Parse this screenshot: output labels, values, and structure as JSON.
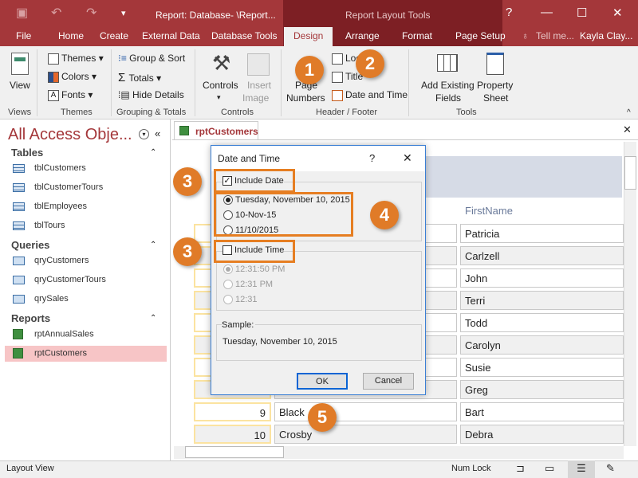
{
  "window": {
    "title": "Report: Database- \\Report...",
    "context_tab_group": "Report Layout Tools",
    "help": "?",
    "minimize": "—",
    "maximize": "☐",
    "close": "✕"
  },
  "tabs": [
    "File",
    "Home",
    "Create",
    "External Data",
    "Database Tools",
    "Design",
    "Arrange",
    "Format",
    "Page Setup"
  ],
  "active_tab": "Design",
  "tell_me": "Tell me...",
  "user": "Kayla Clay...",
  "ribbon": {
    "views": {
      "view": "View",
      "group": "Views"
    },
    "themes": {
      "themes": "Themes",
      "colors": "Colors",
      "fonts": "Fonts",
      "group": "Themes"
    },
    "grouping": {
      "group_sort": "Group & Sort",
      "totals": "Totals",
      "hide_details": "Hide Details",
      "group": "Grouping & Totals"
    },
    "controls": {
      "controls": "Controls",
      "insert_image_1": "Insert",
      "insert_image_2": "Image",
      "group": "Controls"
    },
    "header_footer": {
      "page_numbers_1": "Page",
      "page_numbers_2": "Numbers",
      "logo": "Logo",
      "title": "Title",
      "date_time": "Date and Time",
      "group": "Header / Footer"
    },
    "tools": {
      "add_fields_1": "Add Existing",
      "add_fields_2": "Fields",
      "property_1": "Property",
      "property_2": "Sheet",
      "group": "Tools"
    }
  },
  "nav": {
    "title": "All Access Obje...",
    "sections": [
      {
        "name": "Tables",
        "items": [
          "tblCustomers",
          "tblCustomerTours",
          "tblEmployees",
          "tblTours"
        ]
      },
      {
        "name": "Queries",
        "items": [
          "qryCustomers",
          "qryCustomerTours",
          "qrySales"
        ]
      },
      {
        "name": "Reports",
        "items": [
          "rptAnnualSales",
          "rptCustomers"
        ]
      }
    ],
    "selected": "rptCustomers"
  },
  "document": {
    "tab": "rptCustomers",
    "column_header": "FirstName",
    "rows": [
      {
        "id": "",
        "last": "",
        "first": "Patricia"
      },
      {
        "id": "",
        "last": "",
        "first": "Carlzell"
      },
      {
        "id": "",
        "last": "",
        "first": "John"
      },
      {
        "id": "",
        "last": "",
        "first": "Terri"
      },
      {
        "id": "",
        "last": "",
        "first": "Todd"
      },
      {
        "id": "",
        "last": "",
        "first": "Carolyn"
      },
      {
        "id": "",
        "last": "",
        "first": "Susie"
      },
      {
        "id": "",
        "last": "",
        "first": "Greg"
      },
      {
        "id": "9",
        "last": "Black",
        "first": "Bart"
      },
      {
        "id": "10",
        "last": "Crosby",
        "first": "Debra"
      }
    ]
  },
  "dialog": {
    "title": "Date and Time",
    "help": "?",
    "close": "✕",
    "include_date": {
      "label": "Include Date",
      "checked": true
    },
    "date_formats": [
      {
        "label": "Tuesday, November 10, 2015",
        "selected": true
      },
      {
        "label": "10-Nov-15",
        "selected": false
      },
      {
        "label": "11/10/2015",
        "selected": false
      }
    ],
    "include_time": {
      "label": "Include Time",
      "checked": false
    },
    "time_formats": [
      {
        "label": "12:31:50 PM",
        "selected": true
      },
      {
        "label": "12:31 PM",
        "selected": false
      },
      {
        "label": "12:31",
        "selected": false
      }
    ],
    "sample_label": "Sample:",
    "sample_value": "Tuesday, November 10, 2015",
    "ok": "OK",
    "cancel": "Cancel"
  },
  "callouts": [
    "1",
    "2",
    "3",
    "3",
    "4",
    "5"
  ],
  "status": {
    "left": "Layout View",
    "num_lock": "Num Lock"
  },
  "colors": {
    "accent": "#a4373a",
    "callout": "#e07b28"
  }
}
